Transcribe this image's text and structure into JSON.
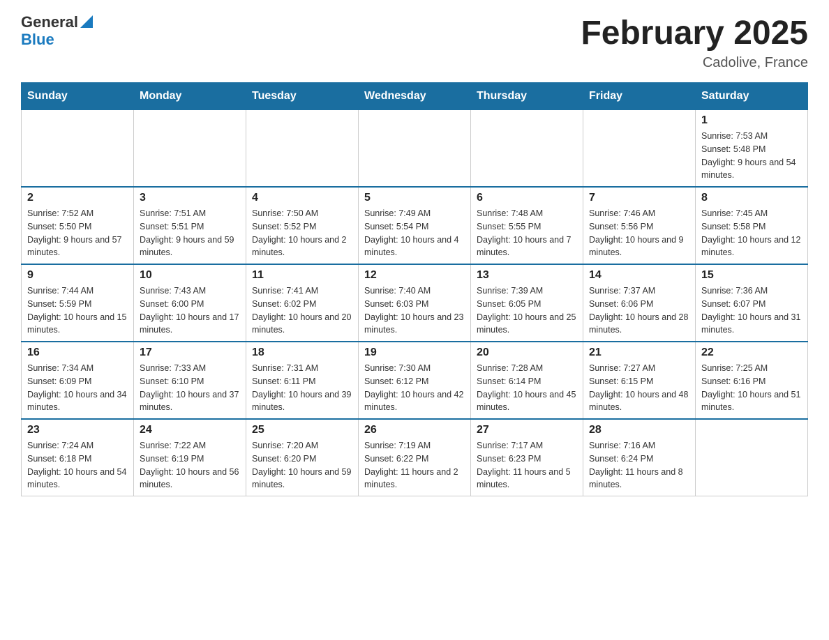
{
  "header": {
    "logo_general": "General",
    "logo_blue": "Blue",
    "title": "February 2025",
    "subtitle": "Cadolive, France"
  },
  "days_of_week": [
    "Sunday",
    "Monday",
    "Tuesday",
    "Wednesday",
    "Thursday",
    "Friday",
    "Saturday"
  ],
  "weeks": [
    [
      {
        "day": "",
        "info": ""
      },
      {
        "day": "",
        "info": ""
      },
      {
        "day": "",
        "info": ""
      },
      {
        "day": "",
        "info": ""
      },
      {
        "day": "",
        "info": ""
      },
      {
        "day": "",
        "info": ""
      },
      {
        "day": "1",
        "info": "Sunrise: 7:53 AM\nSunset: 5:48 PM\nDaylight: 9 hours and 54 minutes."
      }
    ],
    [
      {
        "day": "2",
        "info": "Sunrise: 7:52 AM\nSunset: 5:50 PM\nDaylight: 9 hours and 57 minutes."
      },
      {
        "day": "3",
        "info": "Sunrise: 7:51 AM\nSunset: 5:51 PM\nDaylight: 9 hours and 59 minutes."
      },
      {
        "day": "4",
        "info": "Sunrise: 7:50 AM\nSunset: 5:52 PM\nDaylight: 10 hours and 2 minutes."
      },
      {
        "day": "5",
        "info": "Sunrise: 7:49 AM\nSunset: 5:54 PM\nDaylight: 10 hours and 4 minutes."
      },
      {
        "day": "6",
        "info": "Sunrise: 7:48 AM\nSunset: 5:55 PM\nDaylight: 10 hours and 7 minutes."
      },
      {
        "day": "7",
        "info": "Sunrise: 7:46 AM\nSunset: 5:56 PM\nDaylight: 10 hours and 9 minutes."
      },
      {
        "day": "8",
        "info": "Sunrise: 7:45 AM\nSunset: 5:58 PM\nDaylight: 10 hours and 12 minutes."
      }
    ],
    [
      {
        "day": "9",
        "info": "Sunrise: 7:44 AM\nSunset: 5:59 PM\nDaylight: 10 hours and 15 minutes."
      },
      {
        "day": "10",
        "info": "Sunrise: 7:43 AM\nSunset: 6:00 PM\nDaylight: 10 hours and 17 minutes."
      },
      {
        "day": "11",
        "info": "Sunrise: 7:41 AM\nSunset: 6:02 PM\nDaylight: 10 hours and 20 minutes."
      },
      {
        "day": "12",
        "info": "Sunrise: 7:40 AM\nSunset: 6:03 PM\nDaylight: 10 hours and 23 minutes."
      },
      {
        "day": "13",
        "info": "Sunrise: 7:39 AM\nSunset: 6:05 PM\nDaylight: 10 hours and 25 minutes."
      },
      {
        "day": "14",
        "info": "Sunrise: 7:37 AM\nSunset: 6:06 PM\nDaylight: 10 hours and 28 minutes."
      },
      {
        "day": "15",
        "info": "Sunrise: 7:36 AM\nSunset: 6:07 PM\nDaylight: 10 hours and 31 minutes."
      }
    ],
    [
      {
        "day": "16",
        "info": "Sunrise: 7:34 AM\nSunset: 6:09 PM\nDaylight: 10 hours and 34 minutes."
      },
      {
        "day": "17",
        "info": "Sunrise: 7:33 AM\nSunset: 6:10 PM\nDaylight: 10 hours and 37 minutes."
      },
      {
        "day": "18",
        "info": "Sunrise: 7:31 AM\nSunset: 6:11 PM\nDaylight: 10 hours and 39 minutes."
      },
      {
        "day": "19",
        "info": "Sunrise: 7:30 AM\nSunset: 6:12 PM\nDaylight: 10 hours and 42 minutes."
      },
      {
        "day": "20",
        "info": "Sunrise: 7:28 AM\nSunset: 6:14 PM\nDaylight: 10 hours and 45 minutes."
      },
      {
        "day": "21",
        "info": "Sunrise: 7:27 AM\nSunset: 6:15 PM\nDaylight: 10 hours and 48 minutes."
      },
      {
        "day": "22",
        "info": "Sunrise: 7:25 AM\nSunset: 6:16 PM\nDaylight: 10 hours and 51 minutes."
      }
    ],
    [
      {
        "day": "23",
        "info": "Sunrise: 7:24 AM\nSunset: 6:18 PM\nDaylight: 10 hours and 54 minutes."
      },
      {
        "day": "24",
        "info": "Sunrise: 7:22 AM\nSunset: 6:19 PM\nDaylight: 10 hours and 56 minutes."
      },
      {
        "day": "25",
        "info": "Sunrise: 7:20 AM\nSunset: 6:20 PM\nDaylight: 10 hours and 59 minutes."
      },
      {
        "day": "26",
        "info": "Sunrise: 7:19 AM\nSunset: 6:22 PM\nDaylight: 11 hours and 2 minutes."
      },
      {
        "day": "27",
        "info": "Sunrise: 7:17 AM\nSunset: 6:23 PM\nDaylight: 11 hours and 5 minutes."
      },
      {
        "day": "28",
        "info": "Sunrise: 7:16 AM\nSunset: 6:24 PM\nDaylight: 11 hours and 8 minutes."
      },
      {
        "day": "",
        "info": ""
      }
    ]
  ]
}
